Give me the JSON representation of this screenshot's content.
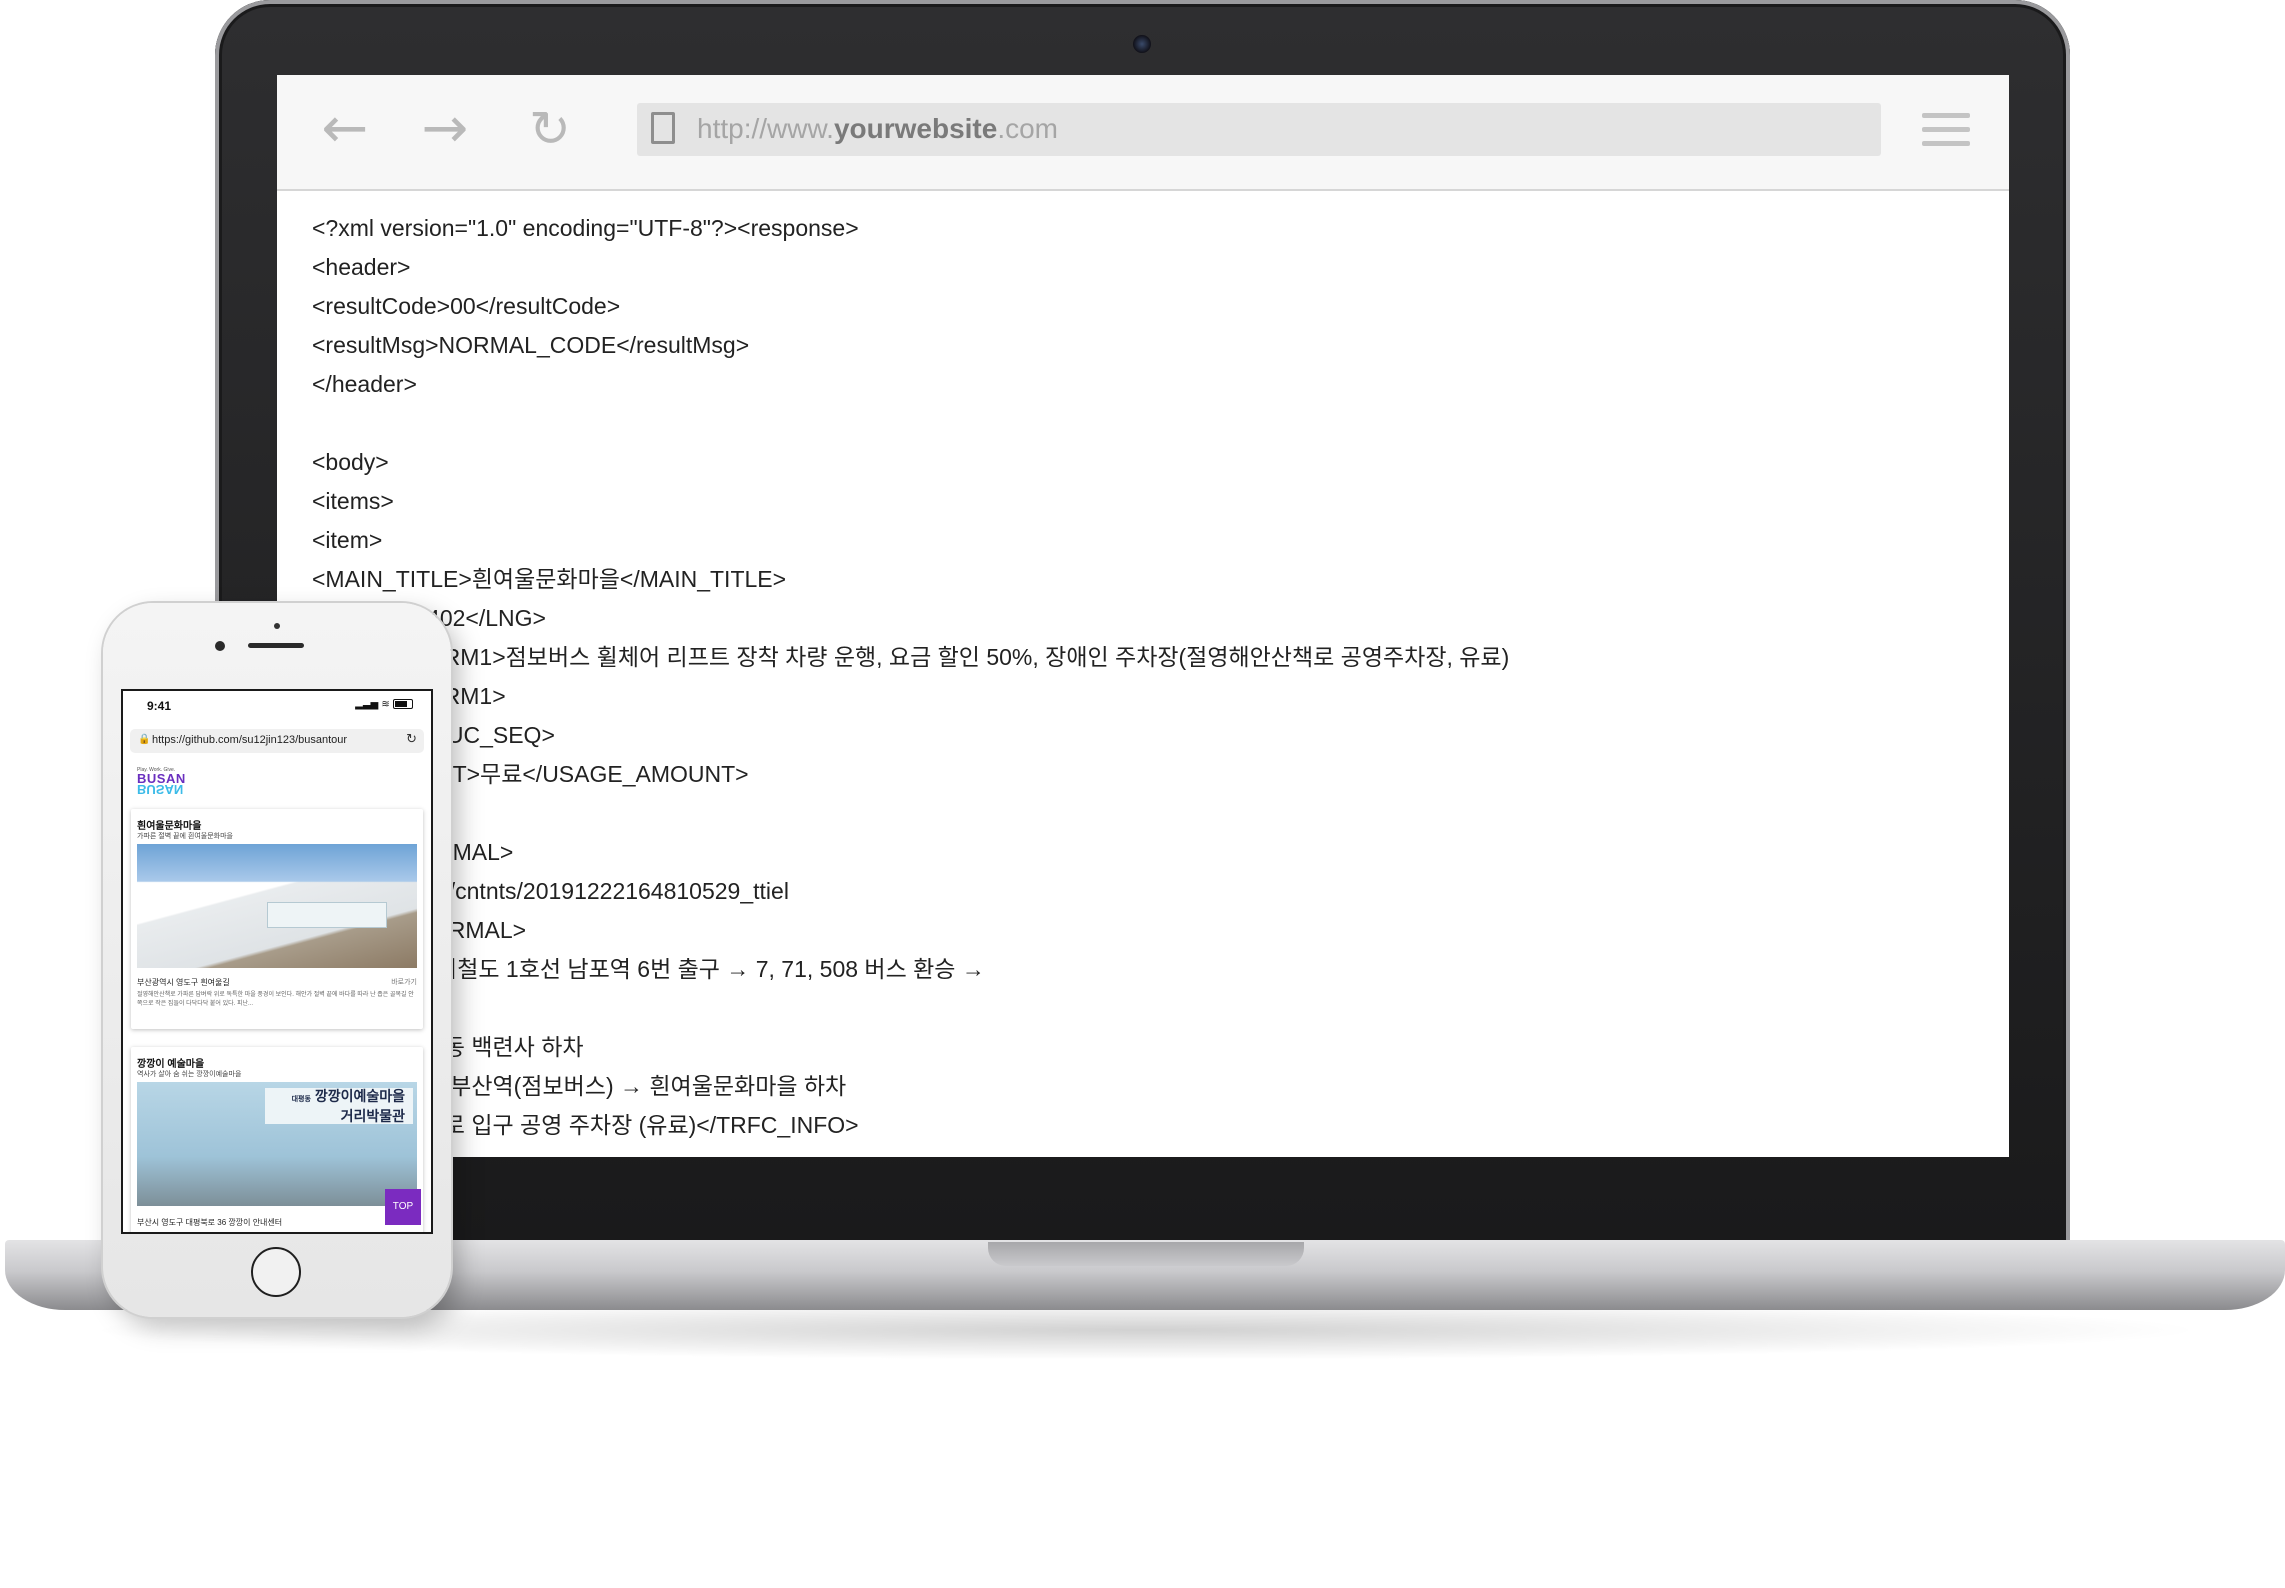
{
  "browser": {
    "back_icon": "arrow-left-icon",
    "forward_icon": "arrow-right-icon",
    "reload_icon": "reload-icon",
    "menu_icon": "hamburger-menu-icon",
    "url_prefix": "http://www.",
    "url_domain": "yourwebsite",
    "url_suffix": ".com"
  },
  "xml_lines": [
    "<?xml version=\"1.0\" encoding=\"UTF-8\"?><response>",
    "<header>",
    "<resultCode>00</resultCode>",
    "<resultMsg>NORMAL_CODE</resultMsg>",
    "</header>",
    "",
    "<body>",
    "<items>",
    "<item>",
    "<MAIN_TITLE>흰여울문화마을</MAIN_TITLE>",
    "              04402</LNG>",
    "              ZE_RM1>점보버스 휠체어 리프트 장착 차량 운행, 요금 할인 50%, 장애인 주차장(절영해안산책로 공영주차장, 유료)",
    "              ZE_RM1>",
    "              55</UC_SEQ>",
    "              OUNT>무료</USAGE_AMOUNT>",
    "              ./>",
    "              NORMAL>",
    "              /files/cntnts/20191222164810529_ttiel",
    "              _NORMAL>",
    "              >도시철도 1호선 남포역 6번 출구 → 7, 71, 508 버스 환승 →",
    "              하차",
    "              영선동 백련사 하차",
    "              버스 부산역(점보버스) → 흰여울문화마을 하차",
    "              산책로 입구 공영 주차장 (유료)</TRFC_INFO>"
  ],
  "phone": {
    "time": "9:41",
    "url": "https://github.com/su12jin123/busantour",
    "logo_tagline": "Play. Work. Give.",
    "logo_text": "BUSAN",
    "card1": {
      "title": "흰여울문화마을",
      "subtitle": "가파른 절벽 끝에 흰여울문화마을",
      "location": "부산광역시 영도구 흰여울길",
      "more": "바로가기",
      "description": "절영해안산책로 가파른 담벼락 위로 독특한 마을 풍경이 보인다. 해안가 절벽 끝에 바다를 따라 난 좁은 골목길 안쪽으로 작은 집들이 다닥다닥 붙어 있다. 피난..."
    },
    "card2": {
      "title": "깡깡이 예술마을",
      "subtitle": "역사가 살아 숨 쉬는 깡깡이예술마을",
      "sign_small": "대평동",
      "sign_line1": "깡깡이예술마을",
      "sign_line2": "거리박물관",
      "location": "부산시 영도구 대평북로 36 깡깡이 안내센터"
    },
    "top_button": "TOP"
  }
}
